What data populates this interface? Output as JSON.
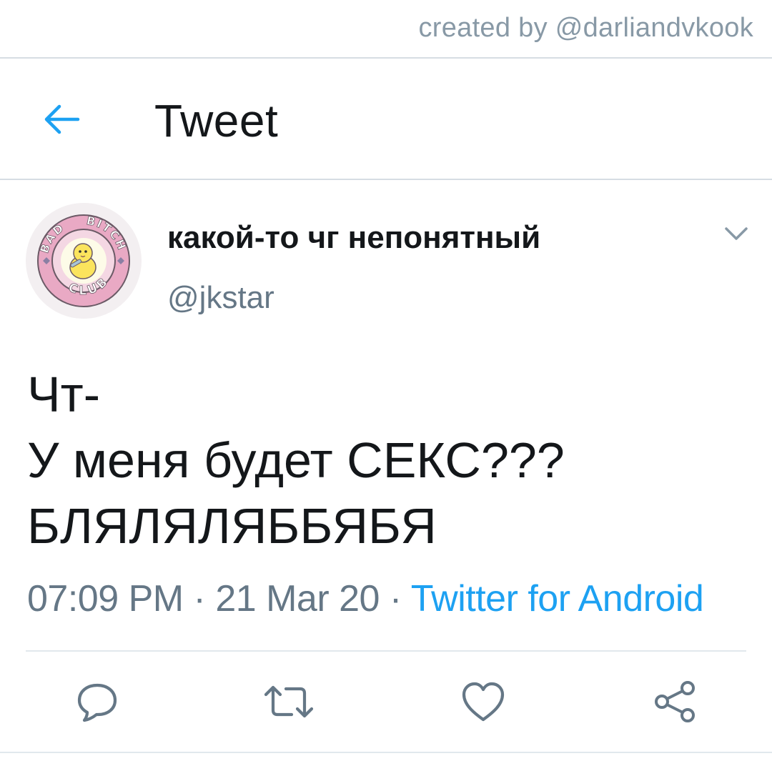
{
  "watermark": "created by @darliandvkook",
  "header": {
    "title": "Tweet",
    "back_icon": "arrow-left-icon"
  },
  "tweet": {
    "display_name": "какой-то чг непонятный",
    "handle": "@jkstar",
    "avatar_text": [
      "BAD",
      "BITCH",
      "CLUB"
    ],
    "lines": [
      "Чт-",
      "У меня будет СЕКС???",
      "БЛЯЛЯЛЯББЯБЯ"
    ],
    "time": "07:09 PM",
    "separator": "·",
    "date": "21 Mar 20",
    "source": "Twitter for Android"
  },
  "actions": [
    {
      "name": "reply",
      "icon": "reply-icon"
    },
    {
      "name": "retweet",
      "icon": "retweet-icon"
    },
    {
      "name": "like",
      "icon": "heart-icon"
    },
    {
      "name": "share",
      "icon": "share-icon"
    }
  ],
  "colors": {
    "accent": "#1da1f2",
    "secondary_text": "#657786",
    "icon": "#657786",
    "divider": "#d6dde3"
  }
}
